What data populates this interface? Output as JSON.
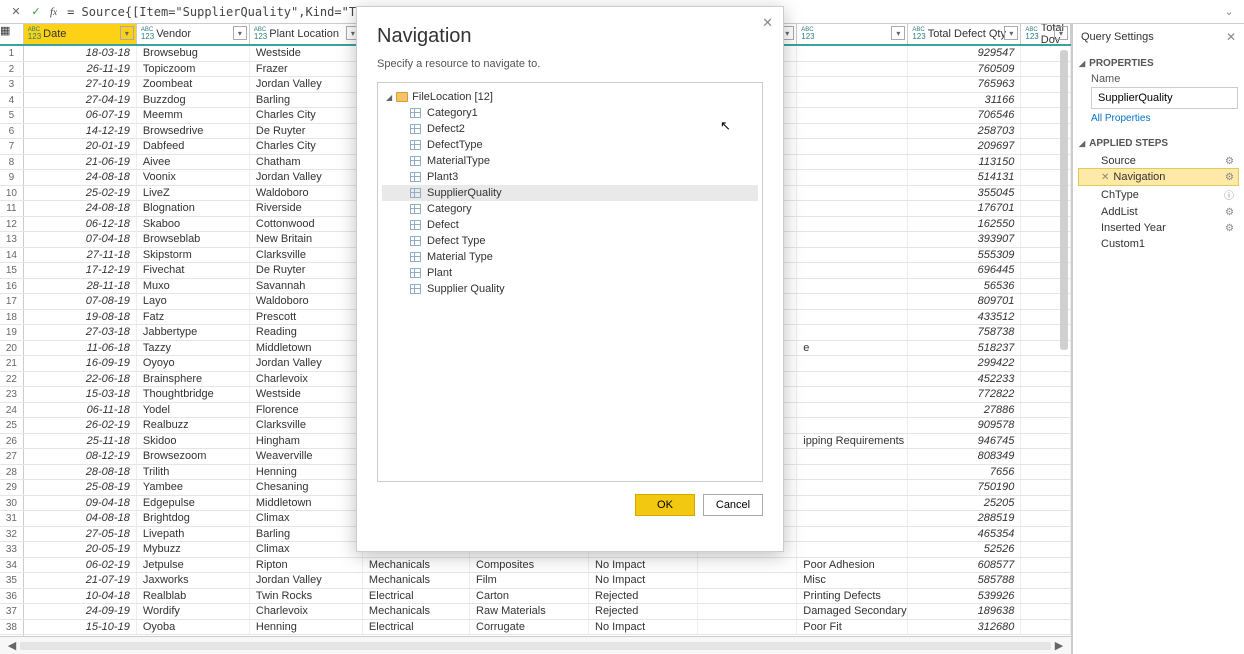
{
  "formula_bar": {
    "formula": "= Source{[Item=\"SupplierQuality\",Kind=\"Table\"]}[Data]"
  },
  "columns": [
    {
      "name": "Date",
      "width": 114,
      "active": true
    },
    {
      "name": "Vendor",
      "width": 114
    },
    {
      "name": "Plant Location",
      "width": 114
    },
    {
      "name": "",
      "width": 108
    },
    {
      "name": "",
      "width": 120
    },
    {
      "name": "",
      "width": 110
    },
    {
      "name": "",
      "width": 100
    },
    {
      "name": "",
      "width": 112
    },
    {
      "name": "Total Defect Qty",
      "width": 114
    },
    {
      "name": "Total Dov",
      "width": 50
    }
  ],
  "rows": [
    {
      "date": "18-03-18",
      "vendor": "Browsebug",
      "loc": "Westside",
      "c3": "",
      "c4": "",
      "c5": "",
      "c6": "",
      "c7": "",
      "qty": "929547"
    },
    {
      "date": "26-11-19",
      "vendor": "Topiczoom",
      "loc": "Frazer",
      "c3": "",
      "c4": "",
      "c5": "",
      "c6": "",
      "c7": "",
      "qty": "760509"
    },
    {
      "date": "27-10-19",
      "vendor": "Zoombeat",
      "loc": "Jordan Valley",
      "c3": "",
      "c4": "",
      "c5": "",
      "c6": "",
      "c7": "",
      "qty": "765963"
    },
    {
      "date": "27-04-19",
      "vendor": "Buzzdog",
      "loc": "Barling",
      "c3": "",
      "c4": "",
      "c5": "",
      "c6": "",
      "c7": "",
      "qty": "31166"
    },
    {
      "date": "06-07-19",
      "vendor": "Meemm",
      "loc": "Charles City",
      "c3": "",
      "c4": "",
      "c5": "",
      "c6": "",
      "c7": "",
      "qty": "706546"
    },
    {
      "date": "14-12-19",
      "vendor": "Browsedrive",
      "loc": "De Ruyter",
      "c3": "",
      "c4": "",
      "c5": "",
      "c6": "",
      "c7": "",
      "qty": "258703"
    },
    {
      "date": "20-01-19",
      "vendor": "Dabfeed",
      "loc": "Charles City",
      "c3": "",
      "c4": "",
      "c5": "",
      "c6": "",
      "c7": "",
      "qty": "209697"
    },
    {
      "date": "21-06-19",
      "vendor": "Aivee",
      "loc": "Chatham",
      "c3": "",
      "c4": "",
      "c5": "",
      "c6": "",
      "c7": "",
      "qty": "113150"
    },
    {
      "date": "24-08-18",
      "vendor": "Voonix",
      "loc": "Jordan Valley",
      "c3": "",
      "c4": "",
      "c5": "",
      "c6": "",
      "c7": "",
      "qty": "514131"
    },
    {
      "date": "25-02-19",
      "vendor": "LiveZ",
      "loc": "Waldoboro",
      "c3": "",
      "c4": "",
      "c5": "",
      "c6": "",
      "c7": "",
      "qty": "355045"
    },
    {
      "date": "24-08-18",
      "vendor": "Blognation",
      "loc": "Riverside",
      "c3": "",
      "c4": "",
      "c5": "",
      "c6": "",
      "c7": "",
      "qty": "176701"
    },
    {
      "date": "06-12-18",
      "vendor": "Skaboo",
      "loc": "Cottonwood",
      "c3": "",
      "c4": "",
      "c5": "",
      "c6": "",
      "c7": "",
      "qty": "162550"
    },
    {
      "date": "07-04-18",
      "vendor": "Browseblab",
      "loc": "New Britain",
      "c3": "",
      "c4": "",
      "c5": "",
      "c6": "",
      "c7": "",
      "qty": "393907"
    },
    {
      "date": "27-11-18",
      "vendor": "Skipstorm",
      "loc": "Clarksville",
      "c3": "",
      "c4": "",
      "c5": "",
      "c6": "",
      "c7": "",
      "qty": "555309"
    },
    {
      "date": "17-12-19",
      "vendor": "Fivechat",
      "loc": "De Ruyter",
      "c3": "",
      "c4": "",
      "c5": "",
      "c6": "",
      "c7": "",
      "qty": "696445"
    },
    {
      "date": "28-11-18",
      "vendor": "Muxo",
      "loc": "Savannah",
      "c3": "",
      "c4": "",
      "c5": "",
      "c6": "",
      "c7": "",
      "qty": "56536"
    },
    {
      "date": "07-08-19",
      "vendor": "Layo",
      "loc": "Waldoboro",
      "c3": "",
      "c4": "",
      "c5": "",
      "c6": "",
      "c7": "",
      "qty": "809701"
    },
    {
      "date": "19-08-18",
      "vendor": "Fatz",
      "loc": "Prescott",
      "c3": "",
      "c4": "",
      "c5": "",
      "c6": "",
      "c7": "",
      "qty": "433512"
    },
    {
      "date": "27-03-18",
      "vendor": "Jabbertype",
      "loc": "Reading",
      "c3": "",
      "c4": "",
      "c5": "",
      "c6": "",
      "c7": "",
      "qty": "758738"
    },
    {
      "date": "11-06-18",
      "vendor": "Tazzy",
      "loc": "Middletown",
      "c3": "",
      "c4": "",
      "c5": "",
      "c6": "",
      "c7": "e",
      "qty": "518237"
    },
    {
      "date": "16-09-19",
      "vendor": "Oyoyo",
      "loc": "Jordan Valley",
      "c3": "",
      "c4": "",
      "c5": "",
      "c6": "",
      "c7": "",
      "qty": "299422"
    },
    {
      "date": "22-06-18",
      "vendor": "Brainsphere",
      "loc": "Charlevoix",
      "c3": "",
      "c4": "",
      "c5": "",
      "c6": "",
      "c7": "",
      "qty": "452233"
    },
    {
      "date": "15-03-18",
      "vendor": "Thoughtbridge",
      "loc": "Westside",
      "c3": "",
      "c4": "",
      "c5": "",
      "c6": "",
      "c7": "",
      "qty": "772822"
    },
    {
      "date": "06-11-18",
      "vendor": "Yodel",
      "loc": "Florence",
      "c3": "",
      "c4": "",
      "c5": "",
      "c6": "",
      "c7": "",
      "qty": "27886"
    },
    {
      "date": "26-02-19",
      "vendor": "Realbuzz",
      "loc": "Clarksville",
      "c3": "",
      "c4": "",
      "c5": "",
      "c6": "",
      "c7": "",
      "qty": "909578"
    },
    {
      "date": "25-11-18",
      "vendor": "Skidoo",
      "loc": "Hingham",
      "c3": "",
      "c4": "",
      "c5": "",
      "c6": "",
      "c7": "ipping Requirements Error",
      "qty": "946745"
    },
    {
      "date": "08-12-19",
      "vendor": "Browsezoom",
      "loc": "Weaverville",
      "c3": "",
      "c4": "",
      "c5": "",
      "c6": "",
      "c7": "",
      "qty": "808349"
    },
    {
      "date": "28-08-18",
      "vendor": "Trilith",
      "loc": "Henning",
      "c3": "",
      "c4": "",
      "c5": "",
      "c6": "",
      "c7": "",
      "qty": "7656"
    },
    {
      "date": "25-08-19",
      "vendor": "Yambee",
      "loc": "Chesaning",
      "c3": "",
      "c4": "",
      "c5": "",
      "c6": "",
      "c7": "",
      "qty": "750190"
    },
    {
      "date": "09-04-18",
      "vendor": "Edgepulse",
      "loc": "Middletown",
      "c3": "",
      "c4": "",
      "c5": "",
      "c6": "",
      "c7": "",
      "qty": "25205"
    },
    {
      "date": "04-08-18",
      "vendor": "Brightdog",
      "loc": "Climax",
      "c3": "",
      "c4": "",
      "c5": "",
      "c6": "",
      "c7": "",
      "qty": "288519"
    },
    {
      "date": "27-05-18",
      "vendor": "Livepath",
      "loc": "Barling",
      "c3": "",
      "c4": "",
      "c5": "",
      "c6": "",
      "c7": "",
      "qty": "465354"
    },
    {
      "date": "20-05-19",
      "vendor": "Mybuzz",
      "loc": "Climax",
      "c3": "",
      "c4": "",
      "c5": "",
      "c6": "",
      "c7": "",
      "qty": "52526"
    },
    {
      "date": "06-02-19",
      "vendor": "Jetpulse",
      "loc": "Ripton",
      "c3": "Mechanicals",
      "c4": "Composites",
      "c5": "No Impact",
      "c6": "",
      "c7": "Poor  Adhesion",
      "qty": "608577"
    },
    {
      "date": "21-07-19",
      "vendor": "Jaxworks",
      "loc": "Jordan Valley",
      "c3": "Mechanicals",
      "c4": "Film",
      "c5": "No Impact",
      "c6": "",
      "c7": "Misc",
      "qty": "585788"
    },
    {
      "date": "10-04-18",
      "vendor": "Realblab",
      "loc": "Twin Rocks",
      "c3": "Electrical",
      "c4": "Carton",
      "c5": "Rejected",
      "c6": "",
      "c7": "Printing Defects",
      "qty": "539926"
    },
    {
      "date": "24-09-19",
      "vendor": "Wordify",
      "loc": "Charlevoix",
      "c3": "Mechanicals",
      "c4": "Raw Materials",
      "c5": "Rejected",
      "c6": "",
      "c7": "Damaged Secondary Packaging",
      "qty": "189638"
    },
    {
      "date": "15-10-19",
      "vendor": "Oyoba",
      "loc": "Henning",
      "c3": "Electrical",
      "c4": "Corrugate",
      "c5": "No Impact",
      "c6": "",
      "c7": "Poor Fit",
      "qty": "312680"
    }
  ],
  "panel": {
    "title": "Query Settings",
    "properties": "PROPERTIES",
    "name_label": "Name",
    "name_value": "SupplierQuality",
    "all_properties": "All Properties",
    "applied_steps": "APPLIED STEPS",
    "steps": [
      {
        "label": "Source",
        "gear": true
      },
      {
        "label": "Navigation",
        "gear": true,
        "selected": true,
        "x": true
      },
      {
        "label": "ChType",
        "info": true
      },
      {
        "label": "AddList",
        "gear": true
      },
      {
        "label": "Inserted Year",
        "gear": true
      },
      {
        "label": "Custom1"
      }
    ]
  },
  "modal": {
    "title": "Navigation",
    "subtitle": "Specify a resource to navigate to.",
    "root": "FileLocation [12]",
    "items": [
      {
        "label": "Category1"
      },
      {
        "label": "Defect2"
      },
      {
        "label": "DefectType"
      },
      {
        "label": "MaterialType"
      },
      {
        "label": "Plant3"
      },
      {
        "label": "SupplierQuality",
        "sel": true
      },
      {
        "label": "Category"
      },
      {
        "label": "Defect"
      },
      {
        "label": "Defect Type"
      },
      {
        "label": "Material Type"
      },
      {
        "label": "Plant"
      },
      {
        "label": "Supplier Quality"
      }
    ],
    "ok": "OK",
    "cancel": "Cancel"
  }
}
